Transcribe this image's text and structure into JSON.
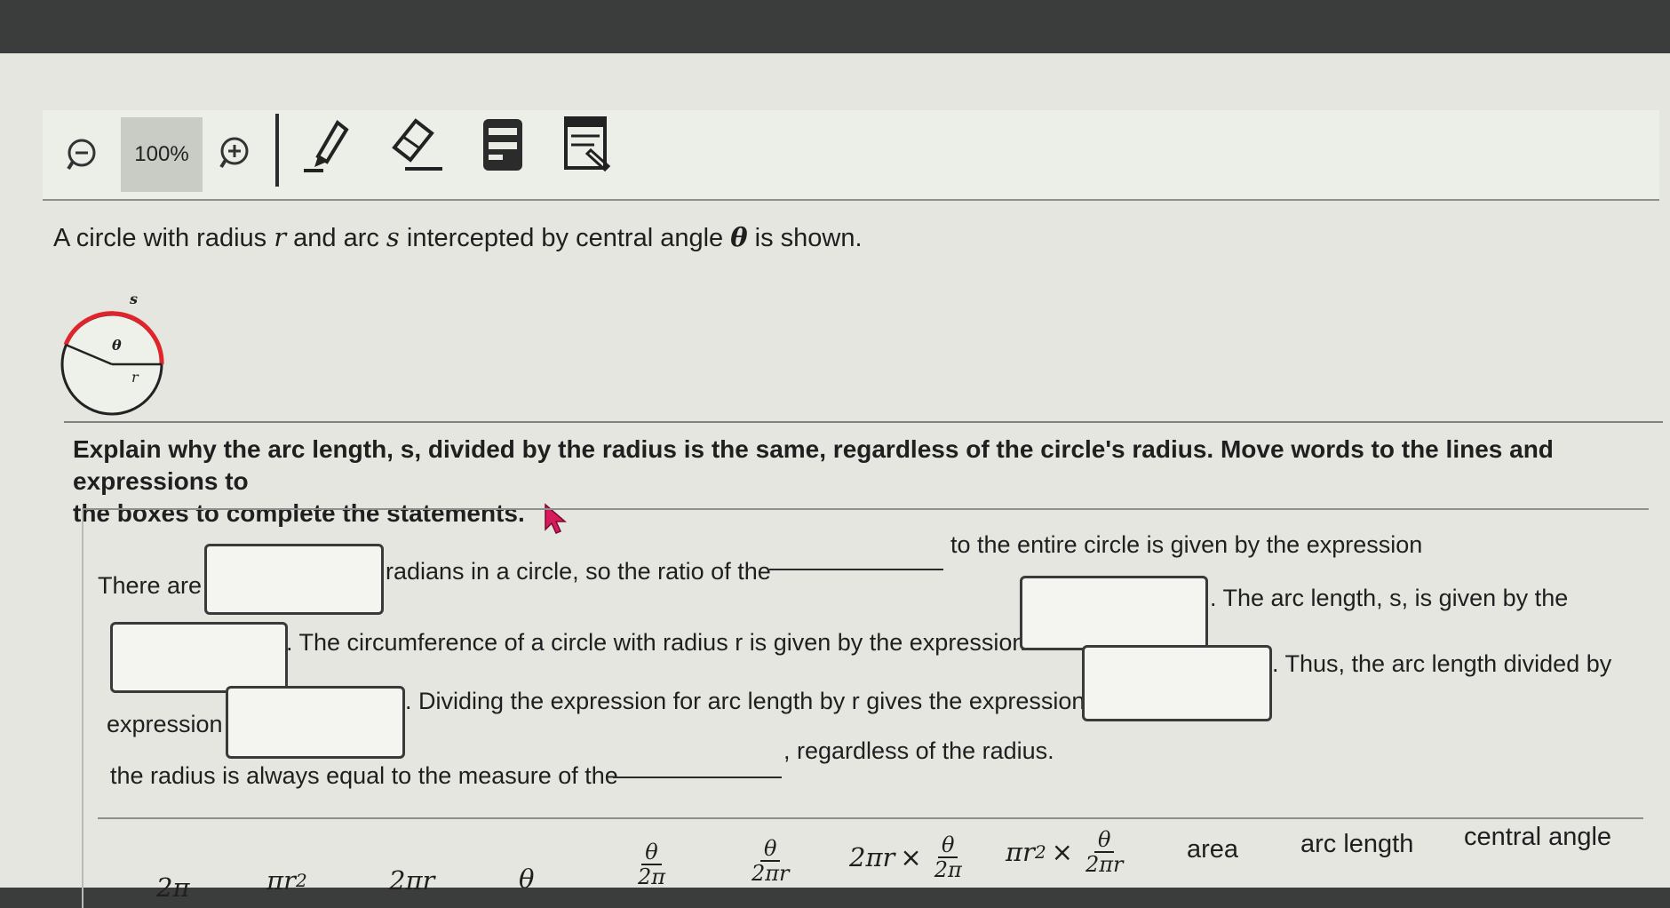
{
  "toolbar": {
    "zoom_level": "100%",
    "icons": [
      "zoom-out-icon",
      "zoom-in-icon",
      "pen-icon",
      "eraser-icon",
      "highlighter-icon",
      "notepad-icon"
    ]
  },
  "intro": {
    "part1": "A circle with radius ",
    "var_r": "r",
    "part2": " and arc ",
    "var_s": "s",
    "part3": " intercepted by central angle ",
    "var_theta": "θ",
    "part4": " is shown."
  },
  "diagram": {
    "label_s": "s",
    "label_theta": "θ",
    "label_r": "r",
    "arc_color": "#e0242c"
  },
  "question": {
    "line1": "Explain why the arc length, s, divided by the radius is the same, regardless of the circle's radius. Move words to the lines and expressions to",
    "line2": "the boxes to complete the statements."
  },
  "statements": {
    "s1a": "There are",
    "s1b": "radians in a circle, so the ratio of the",
    "s1c": "to the entire circle is given by the expression",
    "s2a": ". The circumference of a circle with radius r is given by the expression",
    "s2b": ". The arc length, s, is given by the",
    "s3a": "expression",
    "s3b": ". Dividing the expression for arc length by r gives the expression",
    "s3c": ". Thus, the arc length divided by",
    "s4a": "the radius is always equal to the measure of the",
    "s4b": ", regardless of the radius."
  },
  "tiles": {
    "two_pi": "2π",
    "pi_r2_base": "πr",
    "pi_r2_exp": "2",
    "two_pi_r": "2πr",
    "theta": "θ",
    "f1_num": "θ",
    "f1_den": "2π",
    "f2_num": "θ",
    "f2_den": "2πr",
    "f3_pre": "2πr",
    "times": "×",
    "f3_num": "θ",
    "f3_den": "2π",
    "f4_base": "πr",
    "f4_exp": "2",
    "f4_num": "θ",
    "f4_den": "2πr",
    "area": "area",
    "arc_length": "arc length",
    "central_angle": "central angle"
  }
}
